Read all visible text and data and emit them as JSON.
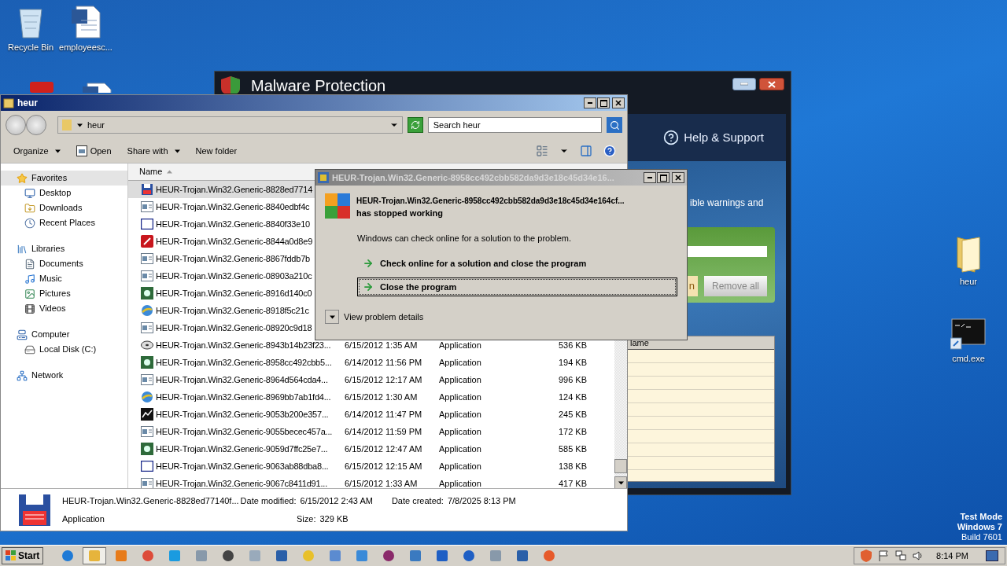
{
  "desktop_icons": [
    {
      "kind": "recycle",
      "label": "Recycle Bin"
    },
    {
      "kind": "document",
      "label": "employeesc..."
    },
    {
      "kind": "app"
    },
    {
      "kind": "document"
    },
    {
      "kind": "folder",
      "label": "heur"
    },
    {
      "kind": "console",
      "label": "cmd.exe"
    }
  ],
  "malware_window": {
    "title": "Malware Protection",
    "help": "Help & Support",
    "text": "ible warnings and",
    "scan_button": "n",
    "remove_button": "Remove all",
    "table_column": "lame"
  },
  "explorer": {
    "title": "heur",
    "address": "heur",
    "search_placeholder": "Search heur",
    "toolbar": [
      {
        "label": "Organize",
        "kind": "menu"
      },
      {
        "label": "Open",
        "kind": "open"
      },
      {
        "label": "Share with",
        "kind": "menu"
      },
      {
        "label": "New folder",
        "kind": "plain"
      }
    ],
    "nav": [
      {
        "label": "Favorites",
        "kind": "star",
        "selected": true,
        "children": [
          {
            "label": "Desktop",
            "kind": "desktop",
            "selected": false
          },
          {
            "label": "Downloads",
            "kind": "downloads",
            "selected": false
          },
          {
            "label": "Recent Places",
            "kind": "recent",
            "selected": false
          }
        ]
      },
      {
        "label": "Libraries",
        "kind": "library",
        "selected": false,
        "children": [
          {
            "label": "Documents",
            "kind": "documents",
            "selected": false
          },
          {
            "label": "Music",
            "kind": "music",
            "selected": false
          },
          {
            "label": "Pictures",
            "kind": "pictures",
            "selected": false
          },
          {
            "label": "Videos",
            "kind": "videos",
            "selected": false
          }
        ]
      },
      {
        "label": "Computer",
        "kind": "computer",
        "selected": false,
        "children": [
          {
            "label": "Local Disk (C:)",
            "kind": "disk",
            "selected": false
          }
        ]
      },
      {
        "label": "Network",
        "kind": "network",
        "selected": false
      }
    ],
    "column": "Name",
    "files": [
      {
        "name": "HEUR-Trojan.Win32.Generic-8828ed7714",
        "selected": true
      },
      {
        "name": "HEUR-Trojan.Win32.Generic-8840edbf4c",
        "selected": false
      },
      {
        "name": "HEUR-Trojan.Win32.Generic-8840f33e10",
        "selected": false
      },
      {
        "name": "HEUR-Trojan.Win32.Generic-8844a0d8e9",
        "selected": false
      },
      {
        "name": "HEUR-Trojan.Win32.Generic-8867fddb7b",
        "selected": false
      },
      {
        "name": "HEUR-Trojan.Win32.Generic-08903a210c",
        "selected": false
      },
      {
        "name": "HEUR-Trojan.Win32.Generic-8916d140c0",
        "selected": false
      },
      {
        "name": "HEUR-Trojan.Win32.Generic-8918f5c21c",
        "selected": false
      },
      {
        "name": "HEUR-Trojan.Win32.Generic-08920c9d18",
        "selected": false
      },
      {
        "name": "HEUR-Trojan.Win32.Generic-8943b14b23f23...",
        "date": "6/15/2012 1:35 AM",
        "type": "Application",
        "size": "536 KB",
        "selected": false
      },
      {
        "name": "HEUR-Trojan.Win32.Generic-8958cc492cbb5...",
        "date": "6/14/2012 11:56 PM",
        "type": "Application",
        "size": "194 KB",
        "selected": false
      },
      {
        "name": "HEUR-Trojan.Win32.Generic-8964d564cda4...",
        "date": "6/15/2012 12:17 AM",
        "type": "Application",
        "size": "996 KB",
        "selected": false
      },
      {
        "name": "HEUR-Trojan.Win32.Generic-8969bb7ab1fd4...",
        "date": "6/15/2012 1:30 AM",
        "type": "Application",
        "size": "124 KB",
        "selected": false
      },
      {
        "name": "HEUR-Trojan.Win32.Generic-9053b200e357...",
        "date": "6/14/2012 11:47 PM",
        "type": "Application",
        "size": "245 KB",
        "selected": false
      },
      {
        "name": "HEUR-Trojan.Win32.Generic-9055becec457a...",
        "date": "6/14/2012 11:59 PM",
        "type": "Application",
        "size": "172 KB",
        "selected": false
      },
      {
        "name": "HEUR-Trojan.Win32.Generic-9059d7ffc25e7...",
        "date": "6/15/2012 12:47 AM",
        "type": "Application",
        "size": "585 KB",
        "selected": false
      },
      {
        "name": "HEUR-Trojan.Win32.Generic-9063ab88dba8...",
        "date": "6/15/2012 12:15 AM",
        "type": "Application",
        "size": "138 KB",
        "selected": false
      },
      {
        "name": "HEUR-Trojan.Win32.Generic-9067c8411d91...",
        "date": "6/15/2012 1:33 AM",
        "type": "Application",
        "size": "417 KB",
        "selected": false
      }
    ],
    "details": {
      "name": "HEUR-Trojan.Win32.Generic-8828ed77140f...",
      "type": "Application",
      "modified_label": "Date modified:",
      "modified": "6/15/2012 2:43 AM",
      "created_label": "Date created:",
      "created": "7/8/2025 8:13 PM",
      "size_label": "Size:",
      "size": "329 KB"
    }
  },
  "dialog": {
    "title": "HEUR-Trojan.Win32.Generic-8958cc492cbb582da9d3e18c45d34e16...",
    "heading": "HEUR-Trojan.Win32.Generic-8958cc492cbb582da9d3e18c45d34e164cf...",
    "heading_2": "has stopped working",
    "message": "Windows can check online for a solution to the problem.",
    "options": [
      {
        "label": "Check online for a solution and close the program",
        "selected": false
      },
      {
        "label": "Close the program",
        "selected": true
      }
    ],
    "details_toggle": "View problem details"
  },
  "taskbar": {
    "start": "Start",
    "apps": [
      {
        "selected": false
      },
      {
        "selected": true
      },
      {
        "selected": false
      },
      {
        "selected": false
      },
      {
        "selected": false
      },
      {
        "selected": false
      },
      {
        "selected": false
      },
      {
        "selected": false
      },
      {
        "selected": false
      },
      {
        "selected": false
      },
      {
        "selected": false
      },
      {
        "selected": false
      },
      {
        "selected": false
      },
      {
        "selected": false
      },
      {
        "selected": false
      },
      {
        "selected": false
      },
      {
        "selected": false
      },
      {
        "selected": false
      },
      {
        "selected": false
      }
    ],
    "time": "8:14 PM"
  },
  "os_notice": [
    "Test Mode",
    "Windows 7",
    "Build 7601"
  ]
}
